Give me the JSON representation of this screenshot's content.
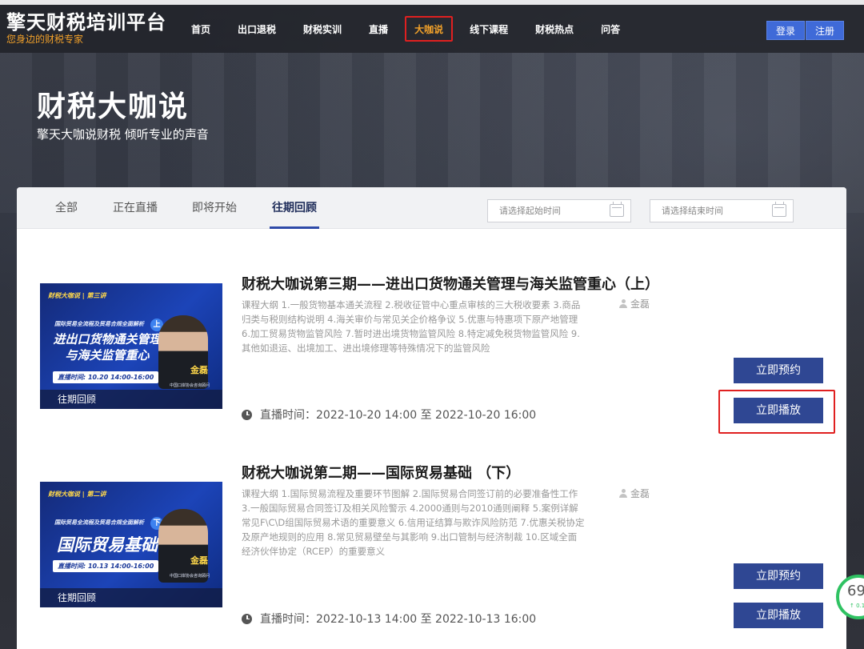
{
  "brand": {
    "name": "擎天财税培训平台",
    "slogan": "您身边的财税专家"
  },
  "nav": {
    "items": [
      {
        "label": "首页"
      },
      {
        "label": "出口退税"
      },
      {
        "label": "财税实训"
      },
      {
        "label": "直播"
      },
      {
        "label": "大咖说",
        "active": true
      },
      {
        "label": "线下课程"
      },
      {
        "label": "财税热点"
      },
      {
        "label": "问答"
      }
    ],
    "login": "登录",
    "register": "注册"
  },
  "hero": {
    "title": "财税大咖说",
    "subtitle": "擎天大咖说财税  倾听专业的声音"
  },
  "tabs": [
    {
      "label": "全部"
    },
    {
      "label": "正在直播"
    },
    {
      "label": "即将开始"
    },
    {
      "label": "往期回顾",
      "active": true
    }
  ],
  "filters": {
    "start_placeholder": "请选择起始时间",
    "end_placeholder": "请选择结束时间"
  },
  "courses": [
    {
      "thumb": {
        "tag": "财税大咖说 | 第三讲",
        "subtitle": "国际贸易全流程及贸易合规全面解析",
        "circle": "上",
        "title": "进出口货物通关管理与海关监管重心",
        "time": "直播时间: 10.20 14:00-16:00",
        "name": "金磊",
        "org": "中国口岸协会咨询顾问",
        "badge": "往期回顾"
      },
      "title": "财税大咖说第三期——进出口货物通关管理与海关监管重心（上）",
      "description": "课程大纲 1.一般货物基本通关流程 2.税收征管中心重点审核的三大税收要素 3.商品归类与税则结构说明 4.海关审价与常见关企价格争议 5.优惠与特惠项下原产地管理 6.加工贸易货物监管风险 7.暂时进出境货物监管风险 8.特定减免税货物监管风险 9.其他如退运、出境加工、进出境修理等特殊情况下的监管风险",
      "teacher": "金磊",
      "live_time": "直播时间：2022-10-20 14:00 至 2022-10-20 16:00",
      "reserve": "立即预约",
      "play": "立即播放"
    },
    {
      "thumb": {
        "tag": "财税大咖说 | 第二讲",
        "subtitle": "国际贸易全流程及贸易合规全面解析",
        "circle": "下",
        "title": "国际贸易基础",
        "time": "直播时间: 10.13 14:00-16:00",
        "name": "金磊",
        "org": "中国口岸协会咨询顾问",
        "badge": "往期回顾"
      },
      "title": "财税大咖说第二期——国际贸易基础 （下）",
      "description": "课程大纲 1.国际贸易流程及重要环节图解 2.国际贸易合同签订前的必要准备性工作 3.一般国际贸易合同签订及相关风险警示 4.2000通则与2010通则阐释 5.案例详解常见F\\C\\D组国际贸易术语的重要意义 6.信用证结算与欺诈风险防范 7.优惠关税协定及原产地规则的应用 8.常见贸易壁垒与其影响 9.出口管制与经济制裁 10.区域全面经济伙伴协定（RCEP）的重要意义",
      "teacher": "金磊",
      "live_time": "直播时间：2022-10-13 14:00 至 2022-10-13 16:00",
      "reserve": "立即预约",
      "play": "立即播放"
    }
  ],
  "float_widget": {
    "value": "69",
    "sub": "↑ 0.1"
  }
}
